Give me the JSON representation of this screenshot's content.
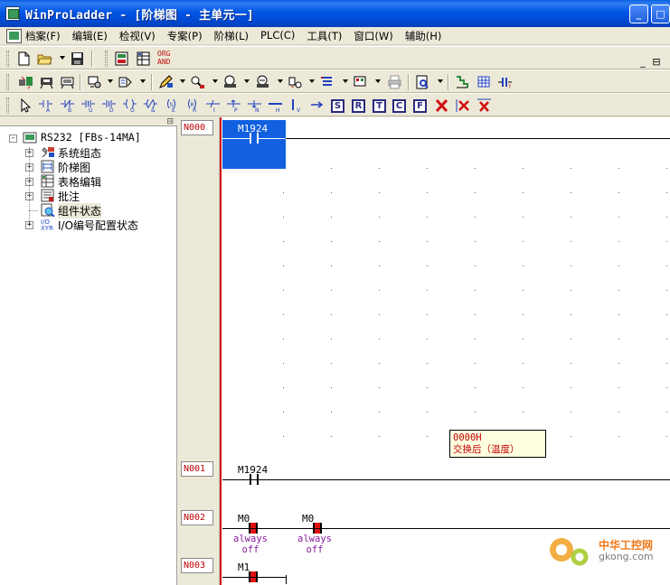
{
  "window": {
    "title": "WinProLadder - [阶梯图 - 主单元一]",
    "minimize_glyph": "_",
    "maximize_glyph": "□"
  },
  "menubar": {
    "items": [
      "档案(F)",
      "编辑(E)",
      "检视(V)",
      "专案(P)",
      "阶梯(L)",
      "PLC(C)",
      "工具(T)",
      "窗口(W)",
      "辅助(H)"
    ],
    "mdi_restore_glyph": "⊟"
  },
  "toolbar1": {
    "icons": [
      "new-file-icon",
      "open-folder-icon",
      "save-icon",
      "project-icon",
      "table-icon"
    ],
    "org_and_label_top": "ORG",
    "org_and_label_bottom": "AND"
  },
  "toolbar3": {
    "boxes": [
      "S",
      "R",
      "T",
      "C",
      "F"
    ]
  },
  "tree": {
    "root_label": "RS232 [FBs-14MA]",
    "items": [
      {
        "label": "系统组态",
        "icon": "system-config-icon",
        "expander": "+"
      },
      {
        "label": "阶梯图",
        "icon": "ladder-diagram-icon",
        "expander": "+"
      },
      {
        "label": "表格编辑",
        "icon": "table-edit-icon",
        "expander": "+"
      },
      {
        "label": "批注",
        "icon": "comment-icon",
        "expander": "+"
      },
      {
        "label": "组件状态",
        "icon": "component-status-icon",
        "expander": ""
      },
      {
        "label": "I/O编号配置状态",
        "icon": "io-config-icon",
        "expander": "+"
      }
    ],
    "root_expander": "-"
  },
  "ladder": {
    "rungs": [
      {
        "id": "N000",
        "contacts": [
          {
            "name": "M1924"
          }
        ]
      },
      {
        "id": "N001",
        "contacts": [
          {
            "name": "M1924"
          }
        ]
      },
      {
        "id": "N002",
        "contacts": [
          {
            "name": "M0",
            "comment1": "always",
            "comment2": "off"
          },
          {
            "name": "M0",
            "comment1": "always",
            "comment2": "off"
          }
        ]
      },
      {
        "id": "N003",
        "contacts": [
          {
            "name": "M1"
          }
        ]
      }
    ],
    "tooltip": {
      "line1": "0000H",
      "line2": "交换后（温度）"
    }
  },
  "watermark": {
    "title": "中华工控网",
    "url": "gkong.com"
  }
}
